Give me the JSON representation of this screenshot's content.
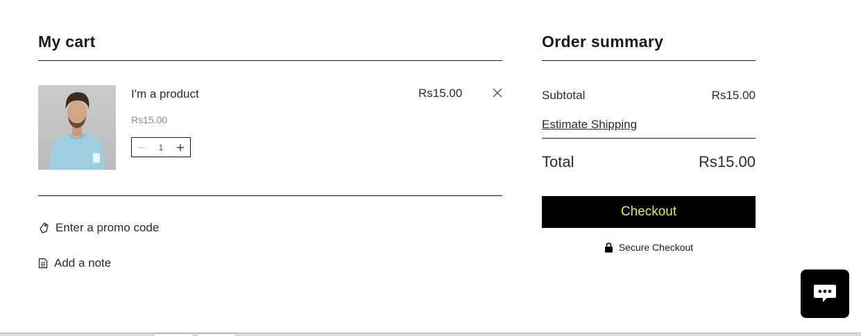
{
  "cart": {
    "heading": "My cart",
    "item": {
      "name": "I'm a product",
      "unit_price": "Rs15.00",
      "quantity": "1",
      "line_total": "Rs15.00"
    },
    "promo_link": "Enter a promo code",
    "note_link": "Add a note"
  },
  "summary": {
    "heading": "Order summary",
    "subtotal_label": "Subtotal",
    "subtotal_value": "Rs15.00",
    "shipping_link": "Estimate Shipping",
    "total_label": "Total",
    "total_value": "Rs15.00",
    "checkout_label": "Checkout",
    "secure_label": "Secure Checkout"
  },
  "icons": {
    "remove": "close-icon",
    "decrement": "minus-icon",
    "increment": "plus-icon",
    "promo": "tag-icon",
    "note": "note-icon",
    "secure": "lock-icon",
    "chat": "chat-icon"
  },
  "colors": {
    "checkout_bg": "#000000",
    "checkout_text": "#d4f243",
    "chat_bg": "#000000"
  }
}
